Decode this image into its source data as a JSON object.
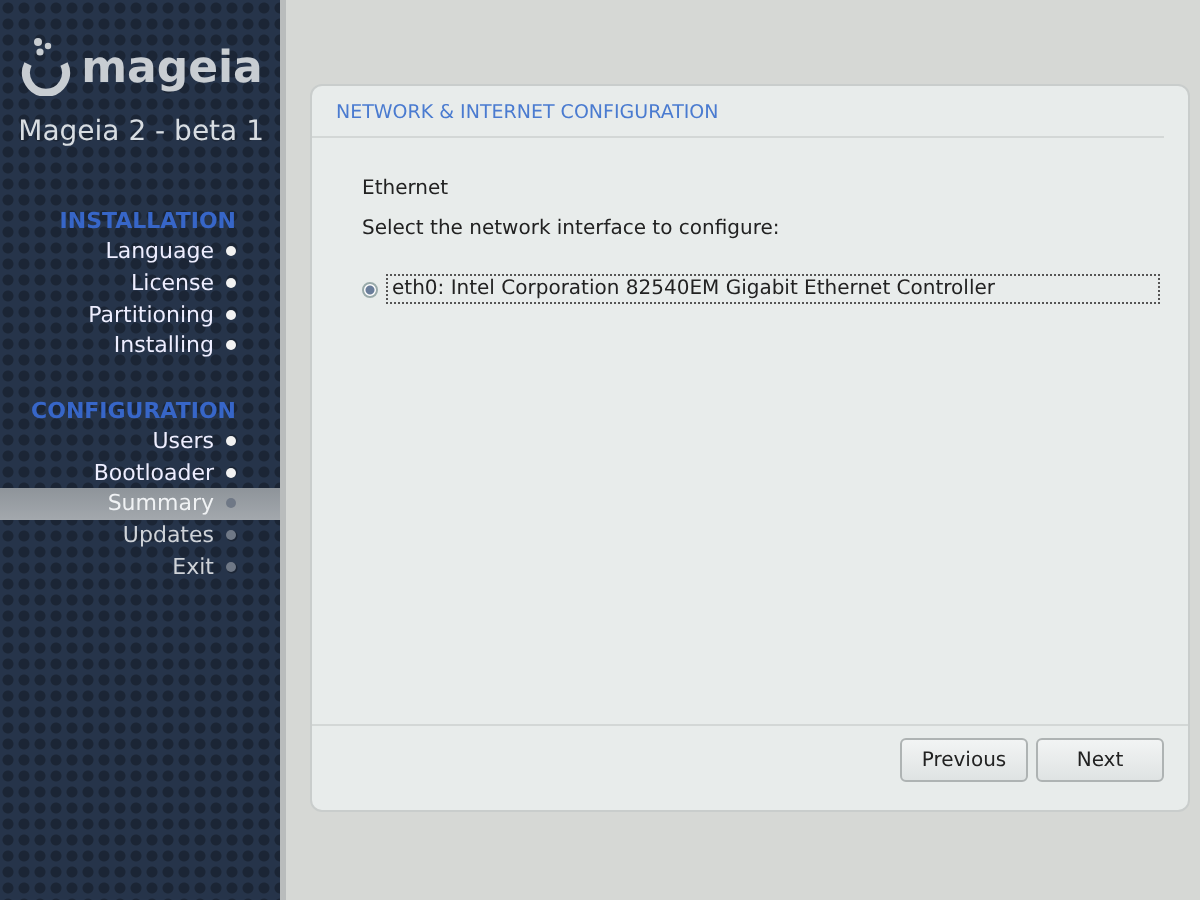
{
  "sidebar": {
    "logo": "mageia",
    "version": "Mageia 2 - beta 1",
    "sections": [
      {
        "title": "INSTALLATION",
        "items": [
          {
            "label": "Language",
            "done": true,
            "selected": false
          },
          {
            "label": "License",
            "done": true,
            "selected": false
          },
          {
            "label": "Partitioning",
            "done": true,
            "selected": false
          },
          {
            "label": "Installing",
            "done": true,
            "selected": false
          }
        ]
      },
      {
        "title": "CONFIGURATION",
        "items": [
          {
            "label": "Users",
            "done": true,
            "selected": false
          },
          {
            "label": "Bootloader",
            "done": true,
            "selected": false
          },
          {
            "label": "Summary",
            "done": false,
            "selected": true
          },
          {
            "label": "Updates",
            "done": false,
            "selected": false
          },
          {
            "label": "Exit",
            "done": false,
            "selected": false
          }
        ]
      }
    ]
  },
  "panel": {
    "title": "NETWORK & INTERNET CONFIGURATION",
    "heading": "Ethernet",
    "prompt": "Select the network interface to configure:",
    "options": [
      {
        "label": "eth0: Intel Corporation 82540EM Gigabit Ethernet Controller",
        "selected": true
      }
    ],
    "buttons": [
      "Previous",
      "Next"
    ]
  }
}
